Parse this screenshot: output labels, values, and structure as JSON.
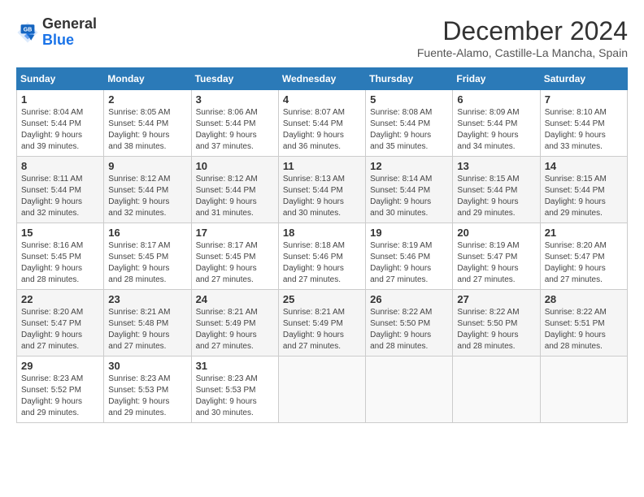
{
  "logo": {
    "line1": "General",
    "line2": "Blue"
  },
  "title": "December 2024",
  "location": "Fuente-Alamo, Castille-La Mancha, Spain",
  "weekdays": [
    "Sunday",
    "Monday",
    "Tuesday",
    "Wednesday",
    "Thursday",
    "Friday",
    "Saturday"
  ],
  "weeks": [
    [
      {
        "day": "1",
        "info": "Sunrise: 8:04 AM\nSunset: 5:44 PM\nDaylight: 9 hours\nand 39 minutes."
      },
      {
        "day": "2",
        "info": "Sunrise: 8:05 AM\nSunset: 5:44 PM\nDaylight: 9 hours\nand 38 minutes."
      },
      {
        "day": "3",
        "info": "Sunrise: 8:06 AM\nSunset: 5:44 PM\nDaylight: 9 hours\nand 37 minutes."
      },
      {
        "day": "4",
        "info": "Sunrise: 8:07 AM\nSunset: 5:44 PM\nDaylight: 9 hours\nand 36 minutes."
      },
      {
        "day": "5",
        "info": "Sunrise: 8:08 AM\nSunset: 5:44 PM\nDaylight: 9 hours\nand 35 minutes."
      },
      {
        "day": "6",
        "info": "Sunrise: 8:09 AM\nSunset: 5:44 PM\nDaylight: 9 hours\nand 34 minutes."
      },
      {
        "day": "7",
        "info": "Sunrise: 8:10 AM\nSunset: 5:44 PM\nDaylight: 9 hours\nand 33 minutes."
      }
    ],
    [
      {
        "day": "8",
        "info": "Sunrise: 8:11 AM\nSunset: 5:44 PM\nDaylight: 9 hours\nand 32 minutes."
      },
      {
        "day": "9",
        "info": "Sunrise: 8:12 AM\nSunset: 5:44 PM\nDaylight: 9 hours\nand 32 minutes."
      },
      {
        "day": "10",
        "info": "Sunrise: 8:12 AM\nSunset: 5:44 PM\nDaylight: 9 hours\nand 31 minutes."
      },
      {
        "day": "11",
        "info": "Sunrise: 8:13 AM\nSunset: 5:44 PM\nDaylight: 9 hours\nand 30 minutes."
      },
      {
        "day": "12",
        "info": "Sunrise: 8:14 AM\nSunset: 5:44 PM\nDaylight: 9 hours\nand 30 minutes."
      },
      {
        "day": "13",
        "info": "Sunrise: 8:15 AM\nSunset: 5:44 PM\nDaylight: 9 hours\nand 29 minutes."
      },
      {
        "day": "14",
        "info": "Sunrise: 8:15 AM\nSunset: 5:44 PM\nDaylight: 9 hours\nand 29 minutes."
      }
    ],
    [
      {
        "day": "15",
        "info": "Sunrise: 8:16 AM\nSunset: 5:45 PM\nDaylight: 9 hours\nand 28 minutes."
      },
      {
        "day": "16",
        "info": "Sunrise: 8:17 AM\nSunset: 5:45 PM\nDaylight: 9 hours\nand 28 minutes."
      },
      {
        "day": "17",
        "info": "Sunrise: 8:17 AM\nSunset: 5:45 PM\nDaylight: 9 hours\nand 27 minutes."
      },
      {
        "day": "18",
        "info": "Sunrise: 8:18 AM\nSunset: 5:46 PM\nDaylight: 9 hours\nand 27 minutes."
      },
      {
        "day": "19",
        "info": "Sunrise: 8:19 AM\nSunset: 5:46 PM\nDaylight: 9 hours\nand 27 minutes."
      },
      {
        "day": "20",
        "info": "Sunrise: 8:19 AM\nSunset: 5:47 PM\nDaylight: 9 hours\nand 27 minutes."
      },
      {
        "day": "21",
        "info": "Sunrise: 8:20 AM\nSunset: 5:47 PM\nDaylight: 9 hours\nand 27 minutes."
      }
    ],
    [
      {
        "day": "22",
        "info": "Sunrise: 8:20 AM\nSunset: 5:47 PM\nDaylight: 9 hours\nand 27 minutes."
      },
      {
        "day": "23",
        "info": "Sunrise: 8:21 AM\nSunset: 5:48 PM\nDaylight: 9 hours\nand 27 minutes."
      },
      {
        "day": "24",
        "info": "Sunrise: 8:21 AM\nSunset: 5:49 PM\nDaylight: 9 hours\nand 27 minutes."
      },
      {
        "day": "25",
        "info": "Sunrise: 8:21 AM\nSunset: 5:49 PM\nDaylight: 9 hours\nand 27 minutes."
      },
      {
        "day": "26",
        "info": "Sunrise: 8:22 AM\nSunset: 5:50 PM\nDaylight: 9 hours\nand 28 minutes."
      },
      {
        "day": "27",
        "info": "Sunrise: 8:22 AM\nSunset: 5:50 PM\nDaylight: 9 hours\nand 28 minutes."
      },
      {
        "day": "28",
        "info": "Sunrise: 8:22 AM\nSunset: 5:51 PM\nDaylight: 9 hours\nand 28 minutes."
      }
    ],
    [
      {
        "day": "29",
        "info": "Sunrise: 8:23 AM\nSunset: 5:52 PM\nDaylight: 9 hours\nand 29 minutes."
      },
      {
        "day": "30",
        "info": "Sunrise: 8:23 AM\nSunset: 5:53 PM\nDaylight: 9 hours\nand 29 minutes."
      },
      {
        "day": "31",
        "info": "Sunrise: 8:23 AM\nSunset: 5:53 PM\nDaylight: 9 hours\nand 30 minutes."
      },
      {
        "day": "",
        "info": ""
      },
      {
        "day": "",
        "info": ""
      },
      {
        "day": "",
        "info": ""
      },
      {
        "day": "",
        "info": ""
      }
    ]
  ]
}
